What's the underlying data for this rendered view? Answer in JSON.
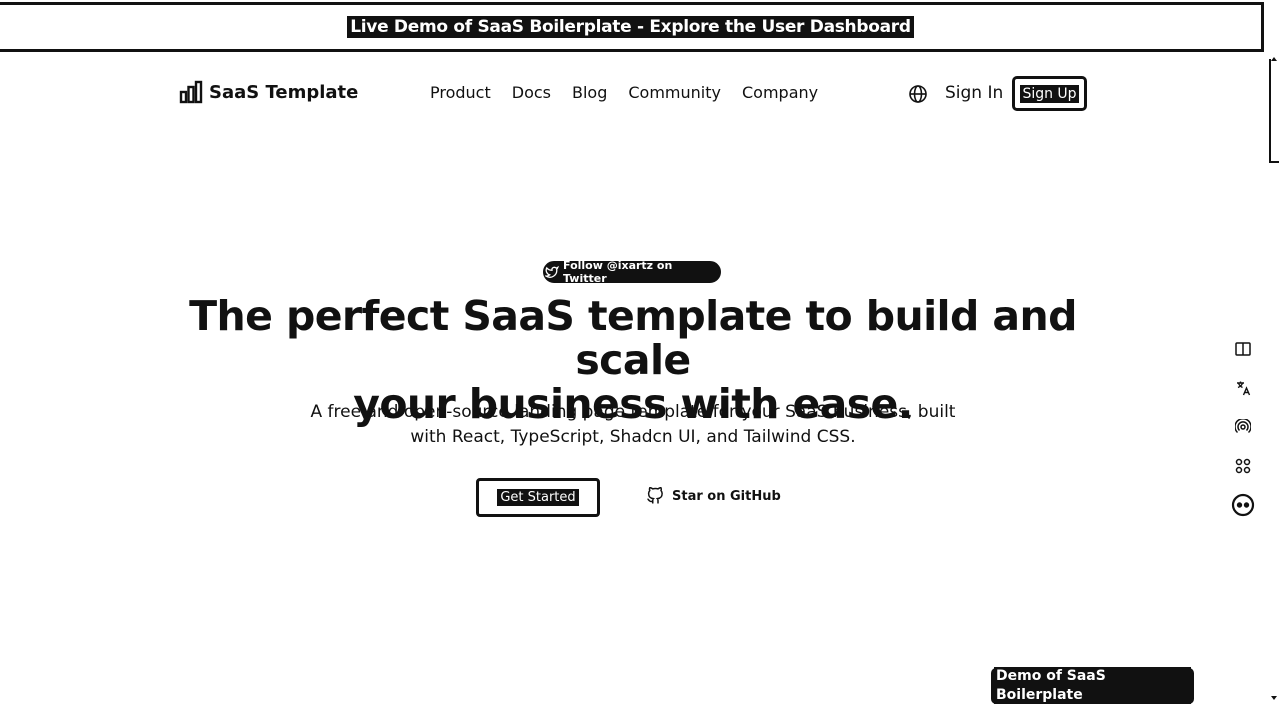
{
  "banner": {
    "text": "Live Demo of SaaS Boilerplate - Explore the User Dashboard"
  },
  "header": {
    "logo_text": "SaaS Template",
    "logo_icon": "bar-chart-icon",
    "nav": [
      "Product",
      "Docs",
      "Blog",
      "Community",
      "Company"
    ],
    "language_icon": "globe-icon",
    "sign_in": "Sign In",
    "sign_up": "Sign Up"
  },
  "hero": {
    "twitter_pill": "Follow @ixartz on Twitter",
    "title_line1": "The perfect SaaS template to build and scale",
    "title_line2": "your business with ease.",
    "subtitle_line1": "A free and open-source landing page template for your SaaS business, built",
    "subtitle_line2": "with React, TypeScript, Shadcn UI, and Tailwind CSS.",
    "cta_primary": "Get Started",
    "cta_secondary": "Star on GitHub"
  },
  "side_tools": [
    "book-icon",
    "translate-icon",
    "broadcast-icon",
    "grid-icon",
    "face-icon"
  ],
  "demo_badge": "Demo of SaaS Boilerplate",
  "colors": {
    "ink": "#111111",
    "background": "#ffffff"
  }
}
